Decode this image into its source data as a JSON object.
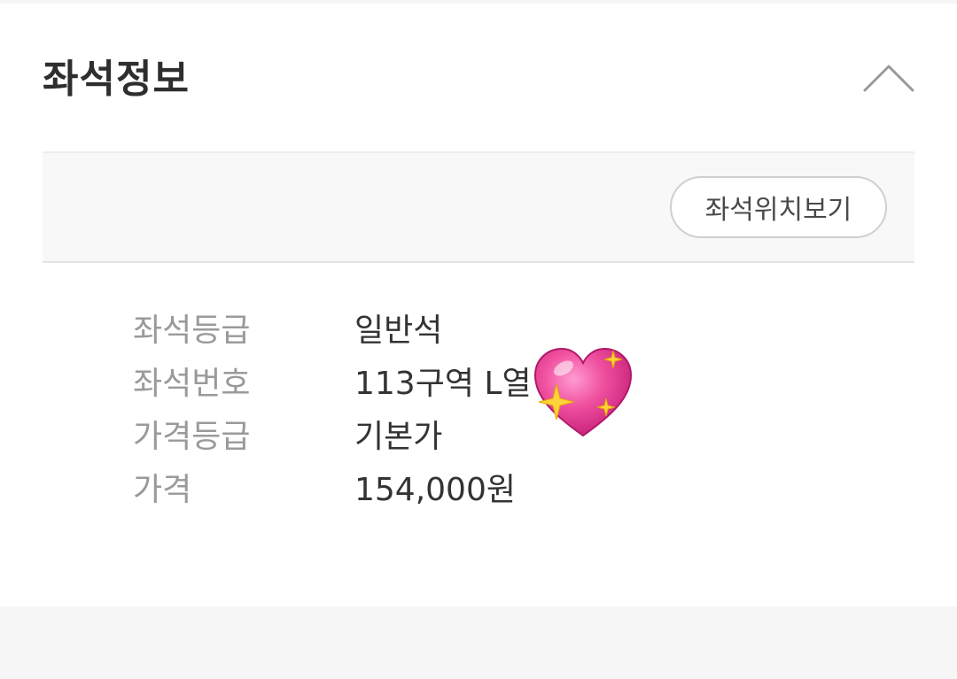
{
  "header": {
    "title": "좌석정보",
    "toggle_icon": "chevron-up-icon"
  },
  "seat_map_button": {
    "label": "좌석위치보기"
  },
  "seat_info": [
    {
      "label": "좌석등급",
      "value": "일반석"
    },
    {
      "label": "좌석번호",
      "value": "113구역 L열"
    },
    {
      "label": "가격등급",
      "value": "기본가"
    },
    {
      "label": "가격",
      "value": "154,000원"
    }
  ],
  "sticker": {
    "icon": "sparkling-heart-icon"
  },
  "colors": {
    "title_text": "#2e2e2e",
    "label_text": "#9a9a9a",
    "value_text": "#333333",
    "heart": "#e8409a",
    "sparkle": "#ffd23c"
  }
}
